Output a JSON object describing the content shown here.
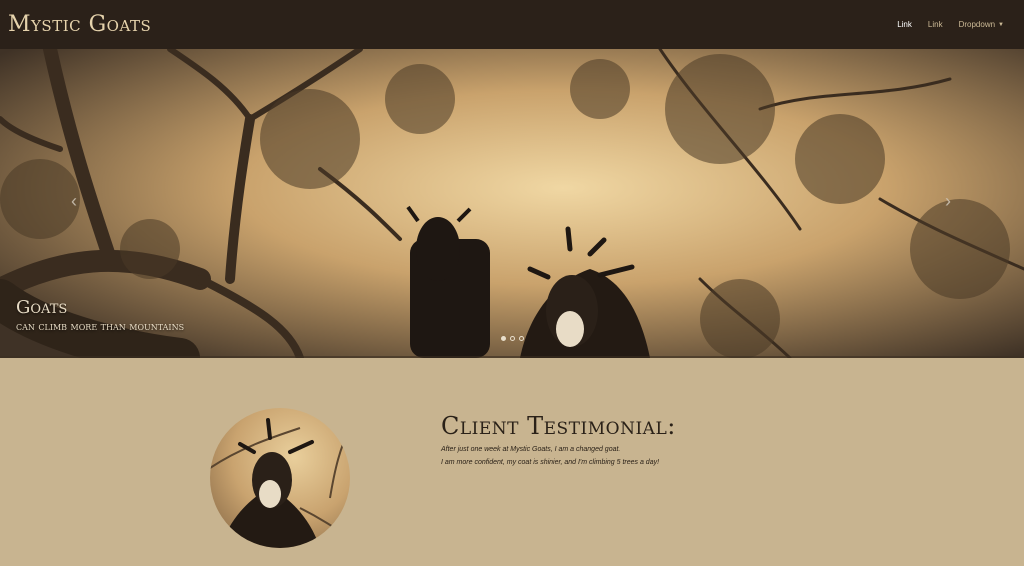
{
  "navbar": {
    "brand": "Mystic Goats",
    "links": [
      {
        "label": "Link",
        "active": true
      },
      {
        "label": "Link",
        "active": false
      },
      {
        "label": "Dropdown",
        "active": false
      }
    ]
  },
  "carousel": {
    "caption_title": "Goats",
    "caption_subtitle": "can climb more than mountains",
    "prev_icon": "chevron-left-icon",
    "next_icon": "chevron-right-icon",
    "slides_count": 3,
    "active_slide": 1
  },
  "testimonial": {
    "heading": "Client Testimonial:",
    "line1": "After just one week at Mystic Goats, I am a changed goat.",
    "line2": "I am more confident, my coat is shinier, and I'm climbing 5 trees a day!"
  },
  "colors": {
    "navbar_bg": "#2b2119",
    "page_bg": "#c8b490",
    "brand_text": "#e6d3ac"
  }
}
